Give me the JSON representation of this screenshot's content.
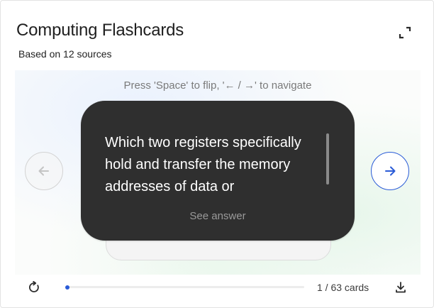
{
  "header": {
    "title": "Computing Flashcards",
    "subtitle": "Based on 12 sources",
    "expand_icon": "fullscreen-icon"
  },
  "hint": "Press 'Space' to flip, '← / →' to navigate",
  "card": {
    "question": "Which two registers specifically hold and transfer the memory addresses of data or",
    "action_label": "See answer"
  },
  "nav": {
    "prev_icon": "arrow-left-icon",
    "next_icon": "arrow-right-icon"
  },
  "footer": {
    "reset_icon": "reset-icon",
    "download_icon": "download-icon",
    "progress": {
      "current": 1,
      "total": 63
    },
    "counter_text": "1 / 63 cards"
  },
  "colors": {
    "accent": "#2a5bd7",
    "card_bg": "#2f2f2f",
    "text": "#1f1f1f",
    "muted": "#7a7a7a"
  }
}
